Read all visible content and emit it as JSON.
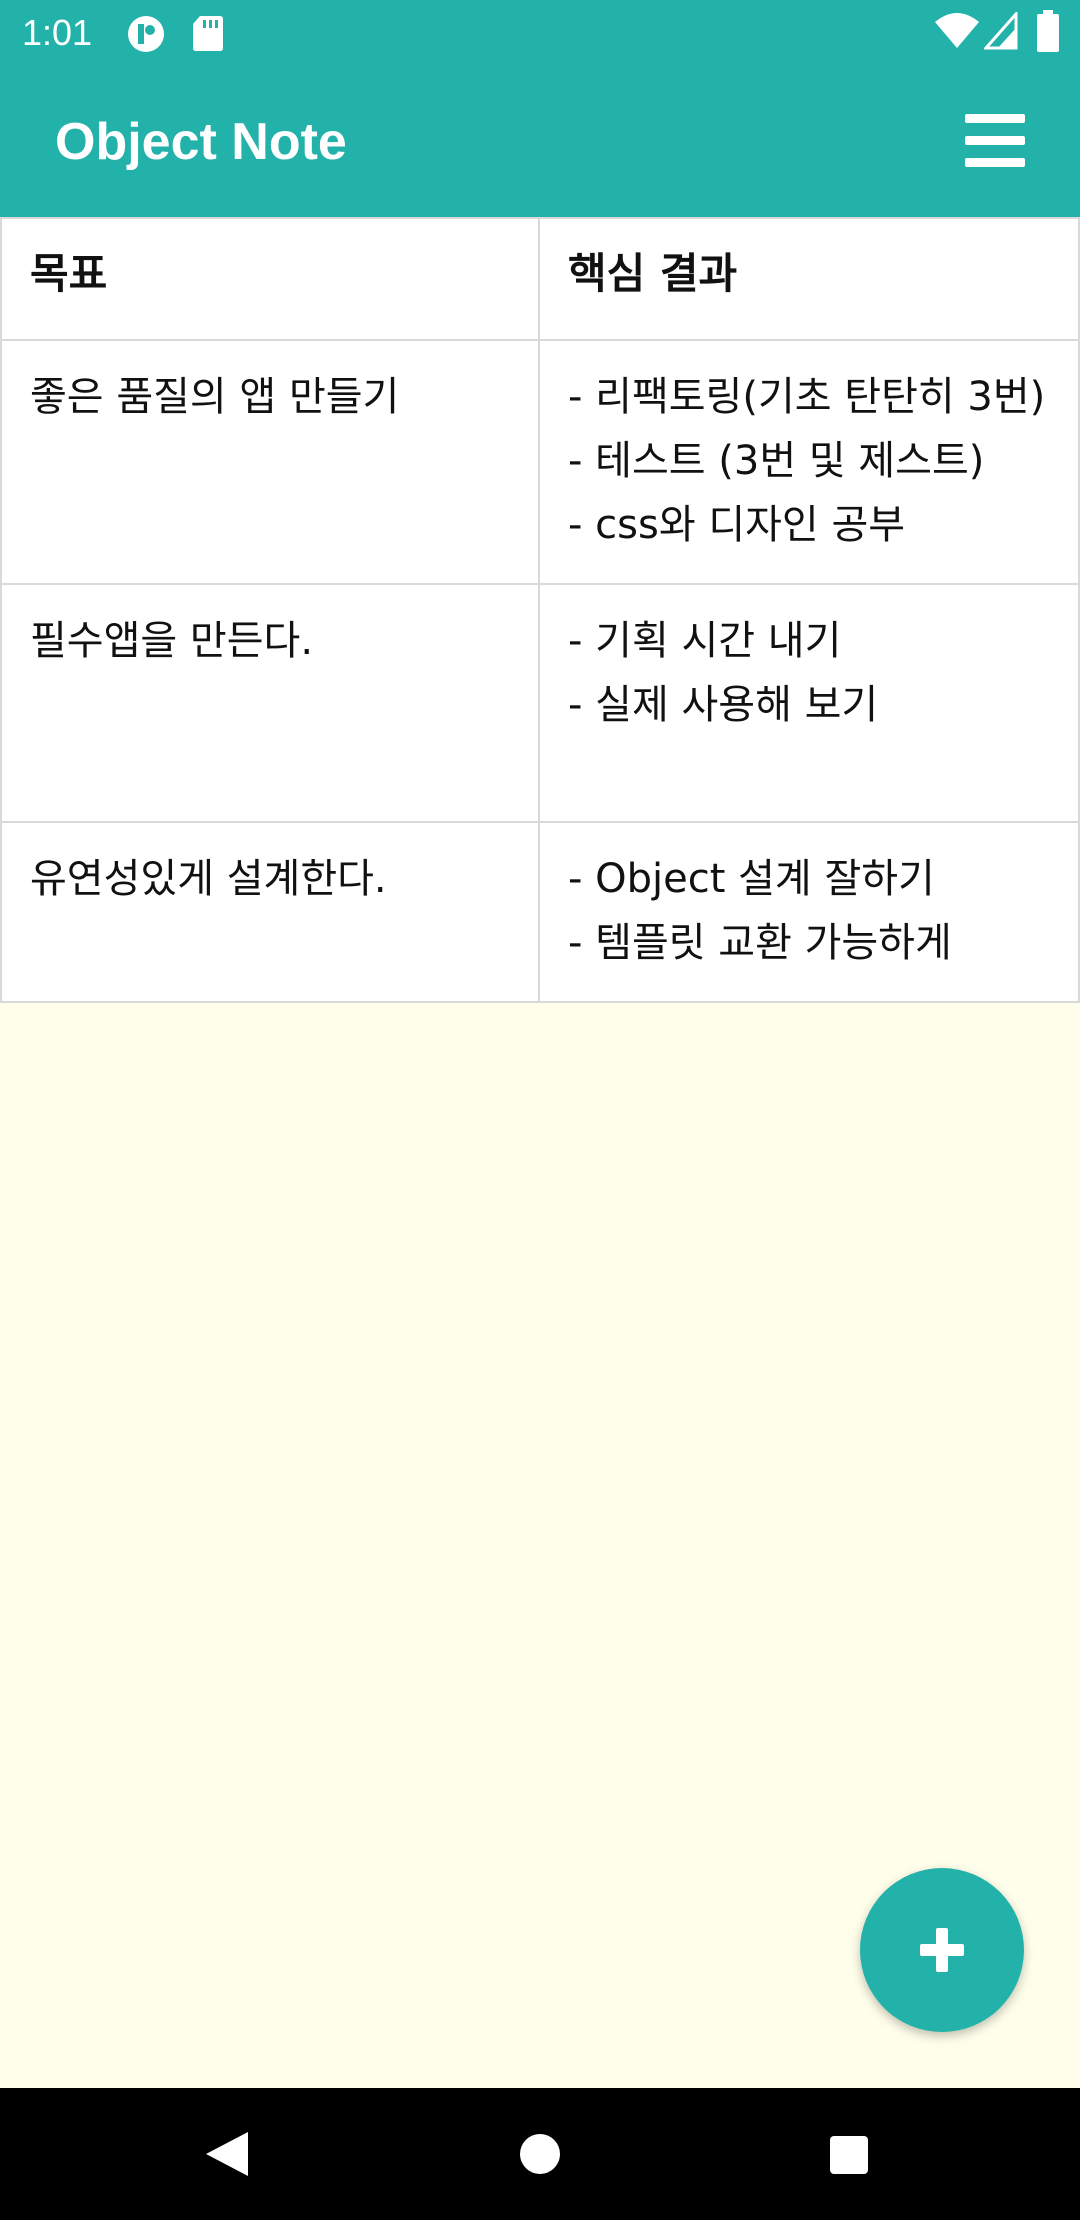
{
  "status_bar": {
    "time": "1:01",
    "icons": [
      "notification-icon",
      "sd-card-icon",
      "wifi-icon",
      "signal-icon",
      "battery-icon"
    ]
  },
  "app_bar": {
    "title": "Object Note",
    "menu_icon": "hamburger-menu-icon"
  },
  "table": {
    "headers": [
      "목표",
      "핵심 결과"
    ],
    "rows": [
      {
        "objective": "좋은 품질의 앱 만들기",
        "key_results": "- 리팩토링(기초 탄탄히 3번)\n- 테스트 (3번 및 제스트)\n- css와 디자인 공부"
      },
      {
        "objective": "필수앱을 만든다.",
        "key_results": "- 기획 시간 내기\n- 실제 사용해 보기"
      },
      {
        "objective": "유연성있게 설계한다.",
        "key_results": "- Object 설계 잘하기\n- 템플릿 교환 가능하게"
      }
    ]
  },
  "fab": {
    "icon": "plus-icon"
  },
  "nav_bar": {
    "icons": [
      "back-icon",
      "home-icon",
      "recents-icon"
    ]
  },
  "colors": {
    "primary": "#22b2aa",
    "background": "#fefeea",
    "table_border": "#d9d9d9"
  }
}
